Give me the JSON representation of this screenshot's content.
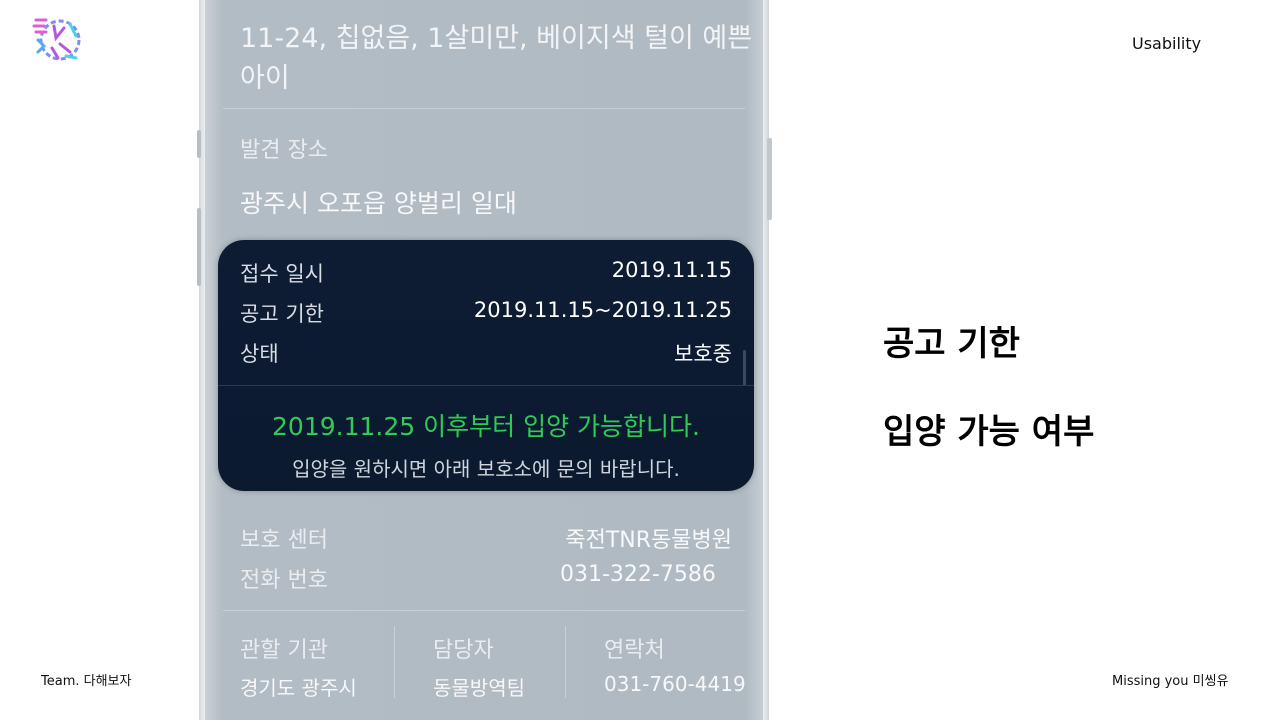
{
  "header": {
    "section_label": "Usability"
  },
  "footer": {
    "team": "Team. 다해보자",
    "project": "Missing you 미씽유"
  },
  "highlights": {
    "line1": "공고 기한",
    "line2": "입양 가능 여부"
  },
  "phone": {
    "title_line1": "11-24, 칩없음, 1살미만, 베이지색 털이 예쁜",
    "title_line2": "아이",
    "found_place_label": "발견 장소",
    "found_place_value": "광주시 오포읍 양벌리 일대",
    "card": {
      "rows": [
        {
          "label": "접수 일시",
          "value": "2019.11.15"
        },
        {
          "label": "공고 기한",
          "value": "2019.11.15~2019.11.25"
        },
        {
          "label": "상태",
          "value": "보호중"
        }
      ],
      "notice": "2019.11.25 이후부터 입양 가능합니다.",
      "sub_notice": "입양을 원하시면 아래 보호소에 문의 바랍니다."
    },
    "shelter_label": "보호 센터",
    "shelter_value": "죽전TNR동물병원",
    "phone_label": "전화 번호",
    "phone_value": "031-322-7586",
    "authority": {
      "headers": [
        "관할 기관",
        "담당자",
        "연락처"
      ],
      "values": [
        "경기도 광주시",
        "동물방역팀",
        "031-760-4419"
      ]
    }
  },
  "colors": {
    "notice_green": "#2ecc55",
    "card_navy": "#0d1c33",
    "screen_overlay": "#b2bcc4"
  }
}
